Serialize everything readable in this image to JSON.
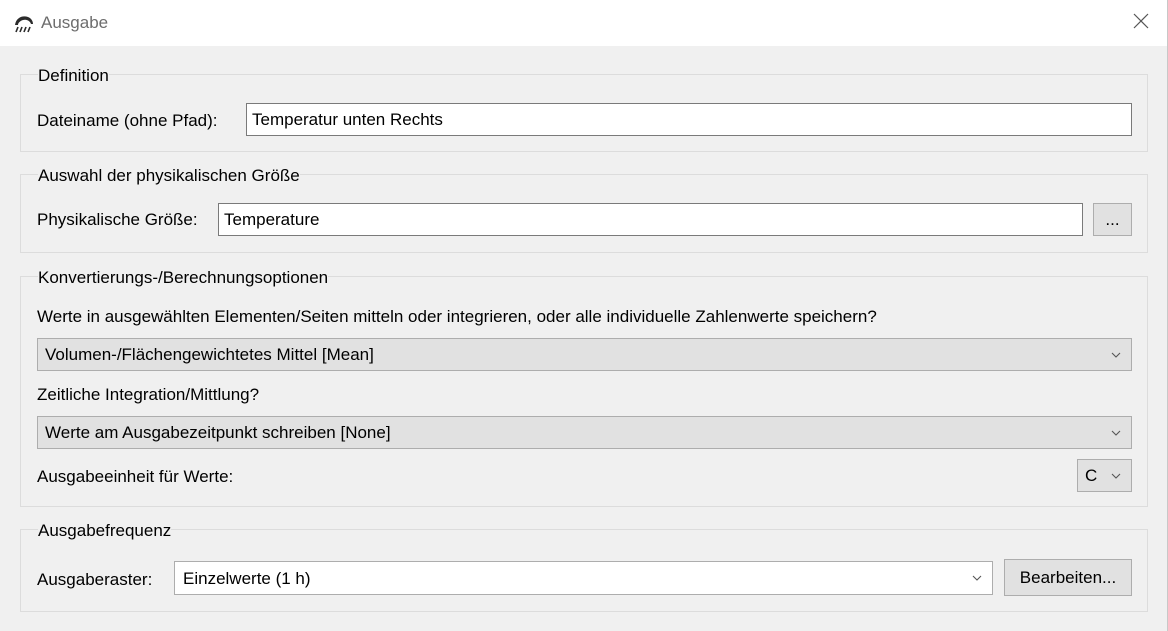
{
  "window": {
    "title": "Ausgabe",
    "icon": "weather-app-icon",
    "close_icon": "close-icon"
  },
  "definition": {
    "group_title": "Definition",
    "filename_label": "Dateiname (ohne Pfad):",
    "filename_value": "Temperatur unten Rechts"
  },
  "quantity": {
    "group_title": "Auswahl der physikalischen Größe",
    "label": "Physikalische Größe:",
    "value": "Temperature",
    "browse_label": "..."
  },
  "conversion": {
    "group_title": "Konvertierungs-/Berechnungsoptionen",
    "question_label": "Werte in ausgewählten Elementen/Seiten mitteln oder integrieren, oder alle individuelle Zahlenwerte speichern?",
    "averaging_selected": "Volumen-/Flächengewichtetes Mittel [Mean]",
    "time_label": "Zeitliche Integration/Mittlung?",
    "time_selected": "Werte am Ausgabezeitpunkt schreiben [None]",
    "unit_label": "Ausgabeeinheit für Werte:",
    "unit_selected": "C"
  },
  "frequency": {
    "group_title": "Ausgabefrequenz",
    "grid_label": "Ausgaberaster:",
    "grid_selected": "Einzelwerte (1 h)",
    "edit_label": "Bearbeiten..."
  }
}
